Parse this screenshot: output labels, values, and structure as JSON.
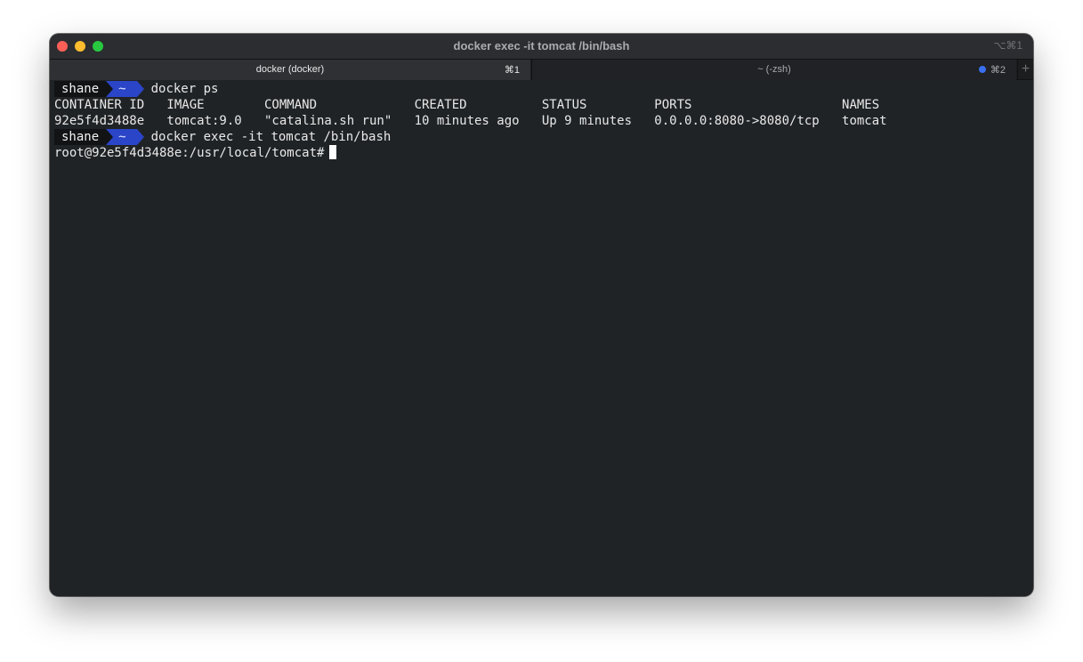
{
  "window": {
    "title": "docker exec -it tomcat /bin/bash",
    "title_shortcut": "⌥⌘1"
  },
  "tabs": [
    {
      "label": "docker (docker)",
      "shortcut": "⌘1",
      "active": true
    },
    {
      "label": "~ (-zsh)",
      "shortcut": "⌘2",
      "active": false,
      "activity_dot_color": "#3a6ff0"
    }
  ],
  "new_tab_label": "+",
  "prompt": {
    "user": "shane",
    "dir": "~",
    "user_bg": "#111315",
    "dir_bg": "#2a45c8"
  },
  "terminal": {
    "cmd1": "docker ps",
    "ps_header": "CONTAINER ID   IMAGE        COMMAND             CREATED          STATUS         PORTS                    NAMES",
    "ps_row": "92e5f4d3488e   tomcat:9.0   \"catalina.sh run\"   10 minutes ago   Up 9 minutes   0.0.0.0:8080->8080/tcp   tomcat",
    "cmd2": "docker exec -it tomcat /bin/bash",
    "root_prompt": "root@92e5f4d3488e:/usr/local/tomcat#"
  },
  "colors": {
    "terminal_bg": "#202326",
    "terminal_fg": "#e8e8e8"
  }
}
